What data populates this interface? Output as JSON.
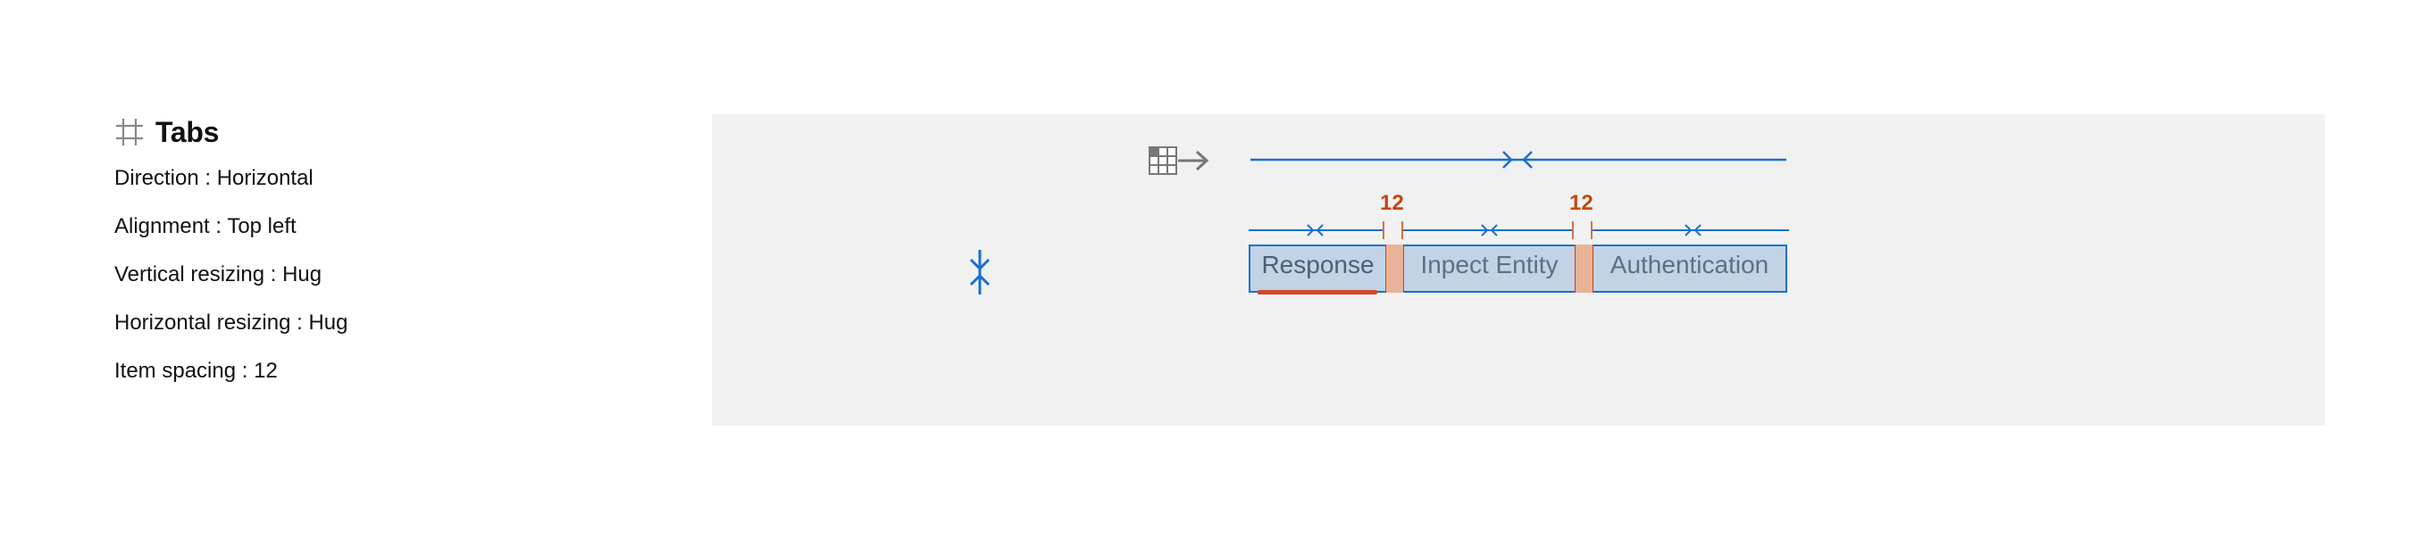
{
  "component": {
    "icon": "frame-icon",
    "title": "Tabs"
  },
  "properties": [
    {
      "label": "Direction",
      "value": "Horizontal"
    },
    {
      "label": "Alignment",
      "value": "Top left"
    },
    {
      "label": "Vertical resizing",
      "value": "Hug"
    },
    {
      "label": "Horizontal resizing",
      "value": "Hug"
    },
    {
      "label": "Item spacing",
      "value": "12"
    }
  ],
  "diagram": {
    "direction_icon": "horizontal-flow-icon",
    "hug_icon": "vertical-hug-icon",
    "tabs": [
      "Response",
      "Inpect Entity",
      "Authentication"
    ],
    "active_tab": "Response",
    "gaps": [
      "12",
      "12"
    ],
    "colors": {
      "measure": "#1a6fd0",
      "frame_fill": "#c3d3e6",
      "gap_fill": "#e8b398",
      "gap_label": "#c4470f",
      "active_indicator": "#d5462d",
      "tab_text": "#5b6f86"
    }
  }
}
